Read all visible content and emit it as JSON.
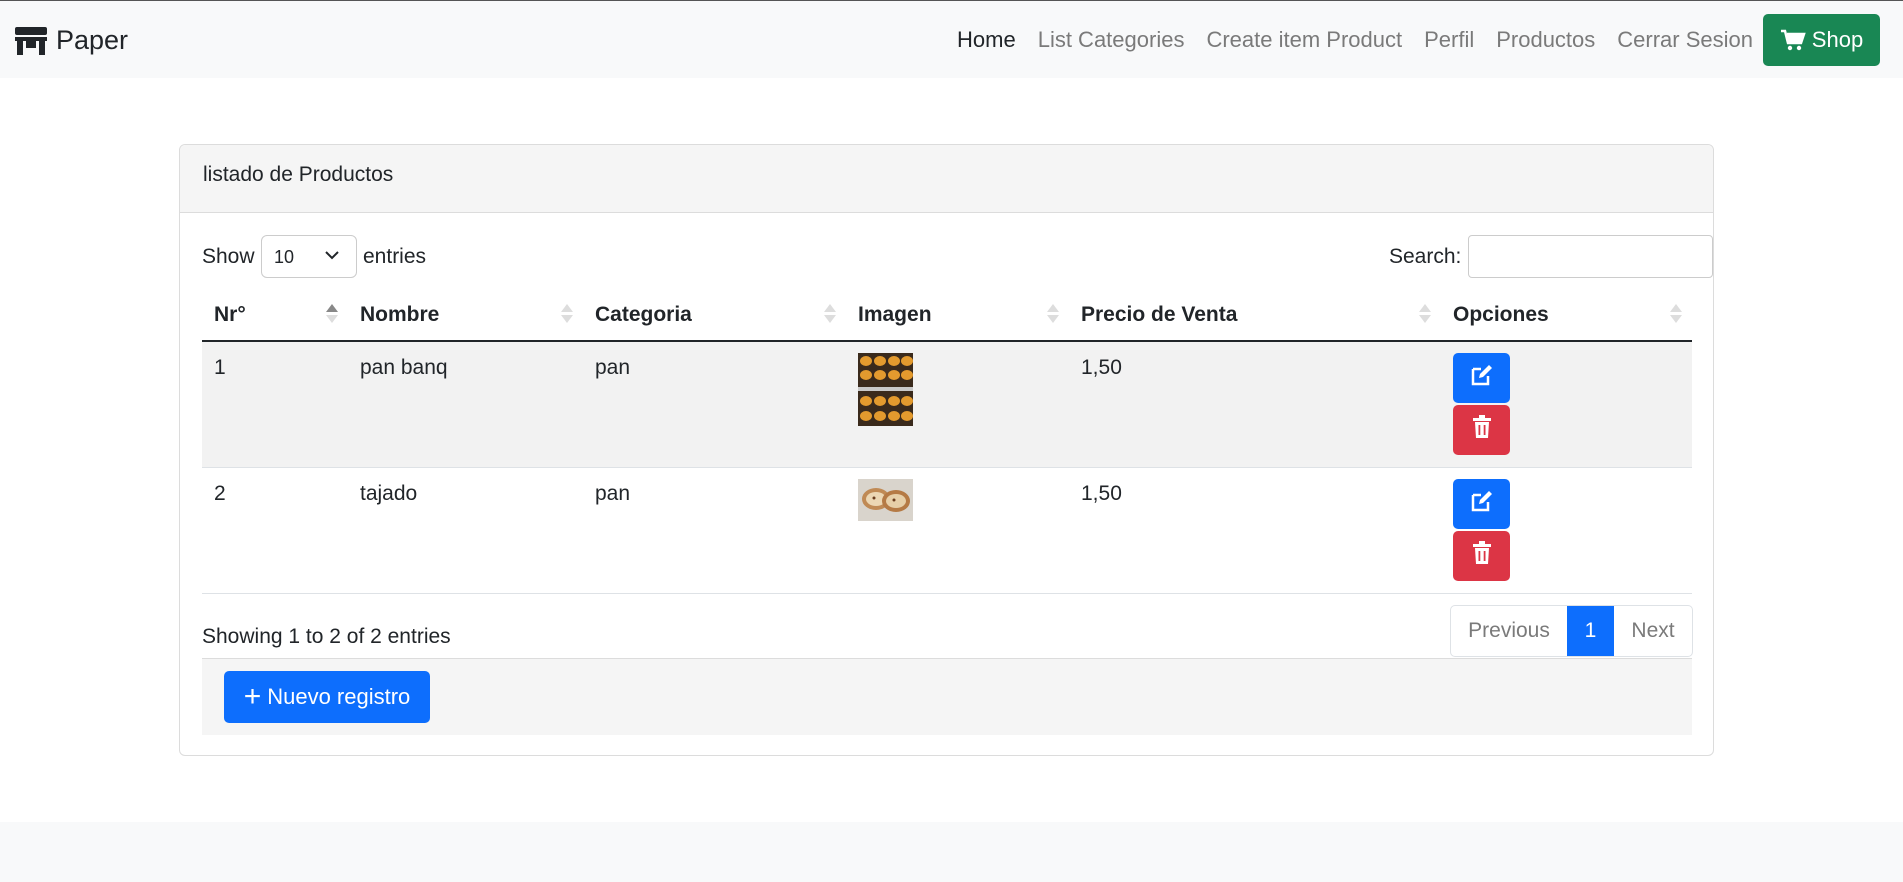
{
  "brand": {
    "name": "Paper",
    "icon": "store-icon"
  },
  "nav": {
    "items": [
      {
        "label": "Home",
        "active": true
      },
      {
        "label": "List Categories",
        "active": false
      },
      {
        "label": "Create item Product",
        "active": false
      },
      {
        "label": "Perfil",
        "active": false
      },
      {
        "label": "Productos",
        "active": false
      },
      {
        "label": "Cerrar Sesion",
        "active": false
      }
    ],
    "shop": {
      "label": "Shop",
      "icon": "cart-icon",
      "color": "#198754"
    }
  },
  "card": {
    "title": "listado de Productos"
  },
  "controls": {
    "show_label": "Show",
    "entries_select": "10",
    "entries_label": "entries",
    "search_label": "Search:",
    "search_value": ""
  },
  "table": {
    "columns": [
      "Nr°",
      "Nombre",
      "Categoria",
      "Imagen",
      "Precio de Venta",
      "Opciones"
    ],
    "rows": [
      {
        "nr": "1",
        "nombre": "pan banq",
        "categoria": "pan",
        "image": "bread-rolls-tray-image",
        "precio": "1,50"
      },
      {
        "nr": "2",
        "nombre": "tajado",
        "categoria": "pan",
        "image": "sliced-bread-image",
        "precio": "1,50"
      }
    ]
  },
  "info": "Showing 1 to 2 of 2 entries",
  "pagination": {
    "previous": "Previous",
    "current": "1",
    "next": "Next"
  },
  "new_button": {
    "label": "Nuevo registro",
    "icon": "plus-icon"
  },
  "colors": {
    "primary": "#0d6efd",
    "danger": "#dc3545",
    "success": "#198754"
  }
}
